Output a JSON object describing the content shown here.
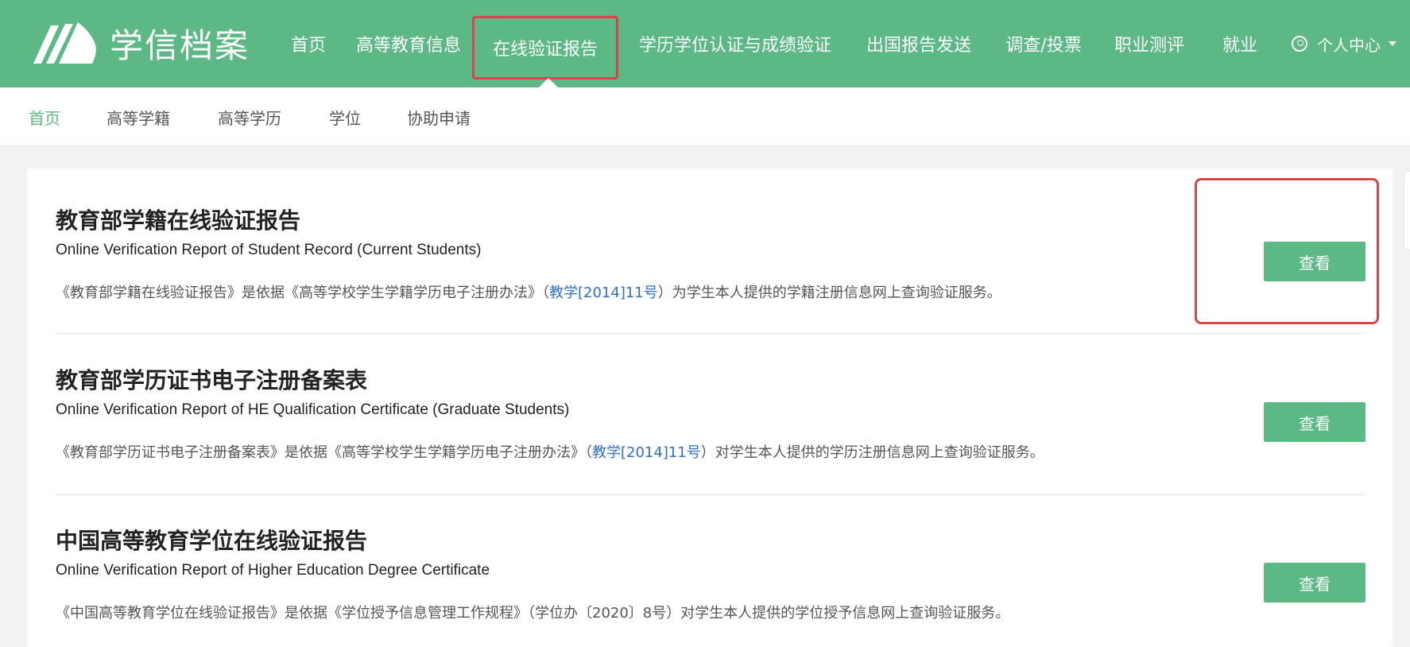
{
  "header": {
    "logo_text": "学信档案",
    "nav": [
      {
        "label": "首页"
      },
      {
        "label": "高等教育信息"
      },
      {
        "label": "在线验证报告"
      },
      {
        "label": "学历学位认证与成绩验证"
      },
      {
        "label": "出国报告发送"
      },
      {
        "label": "调查/投票"
      },
      {
        "label": "职业测评"
      },
      {
        "label": "就业"
      }
    ],
    "user_center": "个人中心",
    "active_nav": "在线验证报告"
  },
  "subnav": {
    "items": [
      {
        "label": "首页"
      },
      {
        "label": "高等学籍"
      },
      {
        "label": "高等学历"
      },
      {
        "label": "学位"
      },
      {
        "label": "协助申请"
      }
    ],
    "active": "首页"
  },
  "colors": {
    "brand": "#5cb885",
    "highlight": "#d9434b",
    "link": "#2f6fc4"
  },
  "reports": [
    {
      "title": "教育部学籍在线验证报告",
      "subtitle": "Online Verification Report of Student Record (Current Students)",
      "desc_pre": "《教育部学籍在线验证报告》是依据《高等学校学生学籍学历电子注册办法》（",
      "desc_link": "教学[2014]11号",
      "desc_post": "）为学生本人提供的学籍注册信息网上查询验证服务。",
      "button": "查看"
    },
    {
      "title": "教育部学历证书电子注册备案表",
      "subtitle": "Online Verification Report of HE Qualification Certificate (Graduate Students)",
      "desc_pre": "《教育部学历证书电子注册备案表》是依据《高等学校学生学籍学历电子注册办法》（",
      "desc_link": "教学[2014]11号",
      "desc_post": "）对学生本人提供的学历注册信息网上查询验证服务。",
      "button": "查看"
    },
    {
      "title": "中国高等教育学位在线验证报告",
      "subtitle": "Online Verification Report of Higher Education Degree Certificate",
      "desc_pre": "《中国高等教育学位在线验证报告》是依据《学位授予信息管理工作规程》（学位办〔2020〕8号）对学生本人提供的学位授予信息网上查询验证服务。",
      "desc_link": "",
      "desc_post": "",
      "button": "查看"
    }
  ]
}
